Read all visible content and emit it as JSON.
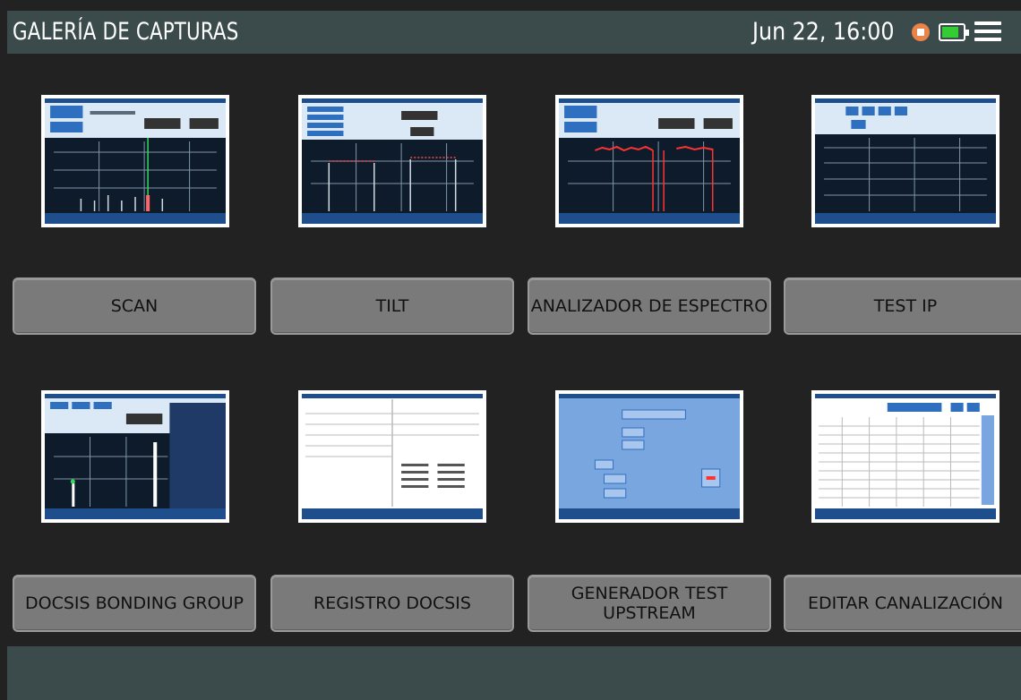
{
  "header": {
    "title": "GALERÍA DE CAPTURAS",
    "datetime": "Jun 22, 16:00"
  },
  "icons": {
    "record": "record-icon",
    "battery": "battery-icon",
    "menu": "hamburger-menu-icon"
  },
  "colors": {
    "header_bg": "#3b4a4a",
    "background": "#222222",
    "button_bg": "#7a7a7a",
    "battery_fill": "#33cc33",
    "record": "#e8844a"
  },
  "gallery": [
    {
      "label": "SCAN",
      "thumbnail": "spectrum-dark"
    },
    {
      "label": "TILT",
      "thumbnail": "tilt-dark"
    },
    {
      "label": "ANALIZADOR DE ESPECTRO",
      "thumbnail": "spectrum-red"
    },
    {
      "label": "TEST IP",
      "thumbnail": "grid-dark"
    },
    {
      "label": "DOCSIS BONDING GROUP",
      "thumbnail": "docsis-dark"
    },
    {
      "label": "REGISTRO DOCSIS",
      "thumbnail": "table-white"
    },
    {
      "label": "GENERADOR TEST UPSTREAM",
      "thumbnail": "form-blue"
    },
    {
      "label": "EDITAR CANALIZACIÓN",
      "thumbnail": "table-list"
    }
  ]
}
